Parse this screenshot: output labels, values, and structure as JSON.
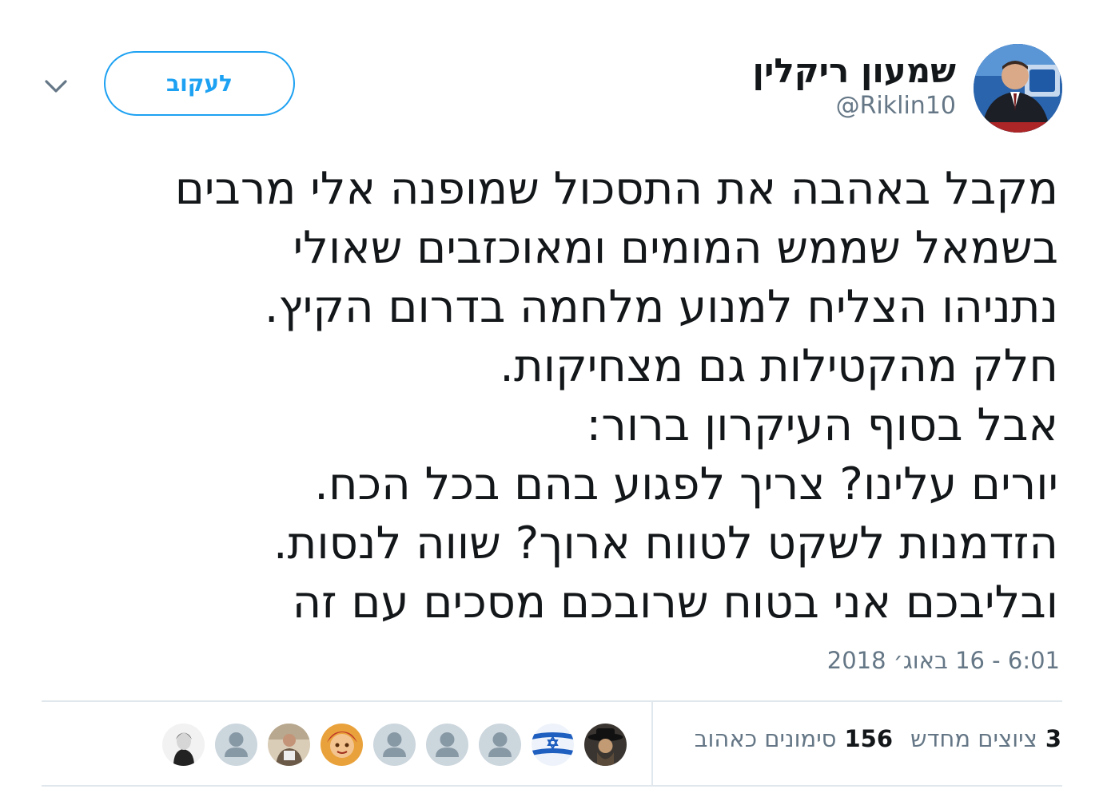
{
  "user": {
    "display_name": "שמעון ריקלין",
    "handle": "@Riklin10",
    "avatar": "profile-photo"
  },
  "actions": {
    "follow_label": "לעקוב",
    "menu_icon": "chevron-down-icon"
  },
  "tweet": {
    "lines": [
      "מקבל באהבה את התסכול שמופנה אלי מרבים",
      "בשמאל שממש המומים ומאוכזבים שאולי",
      "נתניהו הצליח למנוע מלחמה בדרום הקיץ.",
      "חלק מהקטילות גם מצחיקות.",
      "אבל בסוף העיקרון ברור:",
      "יורים עלינו? צריך לפגוע בהם בכל הכח.",
      "הזדמנות לשקט לטווח ארוך? שווה לנסות.",
      "ובליבכם אני בטוח שרובכם מסכים עם זה"
    ],
    "timestamp": "6:01 - 16 באוג׳ 2018"
  },
  "stats": {
    "retweets_count": "3",
    "retweets_label": "ציוצים מחדש",
    "likes_count": "156",
    "likes_label": "סימונים כאהוב"
  },
  "likers": [
    {
      "avatar": "hat-man-photo"
    },
    {
      "avatar": "israel-flag-photo"
    },
    {
      "avatar": "default-avatar"
    },
    {
      "avatar": "default-avatar"
    },
    {
      "avatar": "default-avatar"
    },
    {
      "avatar": "cartoon-face-photo"
    },
    {
      "avatar": "person-photo"
    },
    {
      "avatar": "default-avatar"
    },
    {
      "avatar": "bw-portrait-photo"
    }
  ],
  "colors": {
    "accent": "#1da1f2",
    "text": "#14171a",
    "secondary": "#657786",
    "divider": "#e1e8ed",
    "default_avatar_bg": "#ccd6dd"
  }
}
